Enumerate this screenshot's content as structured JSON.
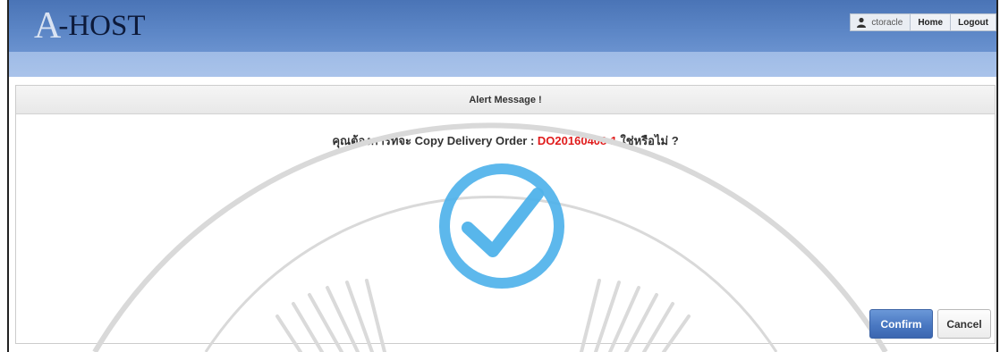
{
  "app": {
    "logo_mark": "A",
    "logo_text": "-HOST"
  },
  "topnav": {
    "username": "ctoracle",
    "home_label": "Home",
    "logout_label": "Logout"
  },
  "dialog": {
    "title": "Alert Message !",
    "message_prefix": "คุณต้องการที่จะ Copy Delivery Order : ",
    "order_number": "DO20160408-1",
    "message_suffix": " ใช่หรือไม่ ?",
    "icon": "check-circle-icon",
    "confirm_label": "Confirm",
    "cancel_label": "Cancel"
  },
  "colors": {
    "header": "#5c86c6",
    "subbar": "#a5c0e9",
    "order_number": "#e01b1b",
    "check_icon": "#4fb2ea",
    "confirm_button": "#4a78c2"
  }
}
